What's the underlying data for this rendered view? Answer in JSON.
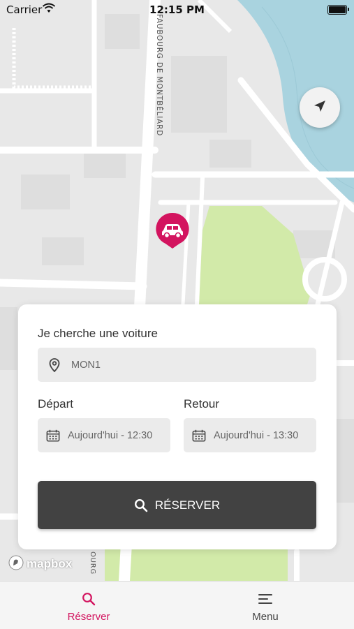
{
  "status_bar": {
    "carrier": "Carrier",
    "time": "12:15 PM"
  },
  "map": {
    "street_label": "FAUBOURG DE MONTBÉLIARD",
    "street_label_bottom": "OURG",
    "attribution": "mapbox",
    "marker": "car-marker",
    "locate_button_icon": "navigation-arrow-icon"
  },
  "booking_card": {
    "title": "Je cherche une voiture",
    "location_value": "MON1",
    "depart_label": "Départ",
    "depart_value": "Aujourd'hui - 12:30",
    "retour_label": "Retour",
    "retour_value": "Aujourd'hui - 13:30",
    "reserve_button": "RÉSERVER"
  },
  "tab_bar": {
    "items": [
      {
        "label": "Réserver",
        "icon": "search-icon",
        "active": true
      },
      {
        "label": "Menu",
        "icon": "menu-icon",
        "active": false
      }
    ]
  },
  "colors": {
    "accent": "#d3145f",
    "button_dark": "#424242",
    "water": "#a9d3df",
    "park": "#d2eaa9",
    "map_background": "#e8e8e8",
    "road": "#ffffff"
  }
}
